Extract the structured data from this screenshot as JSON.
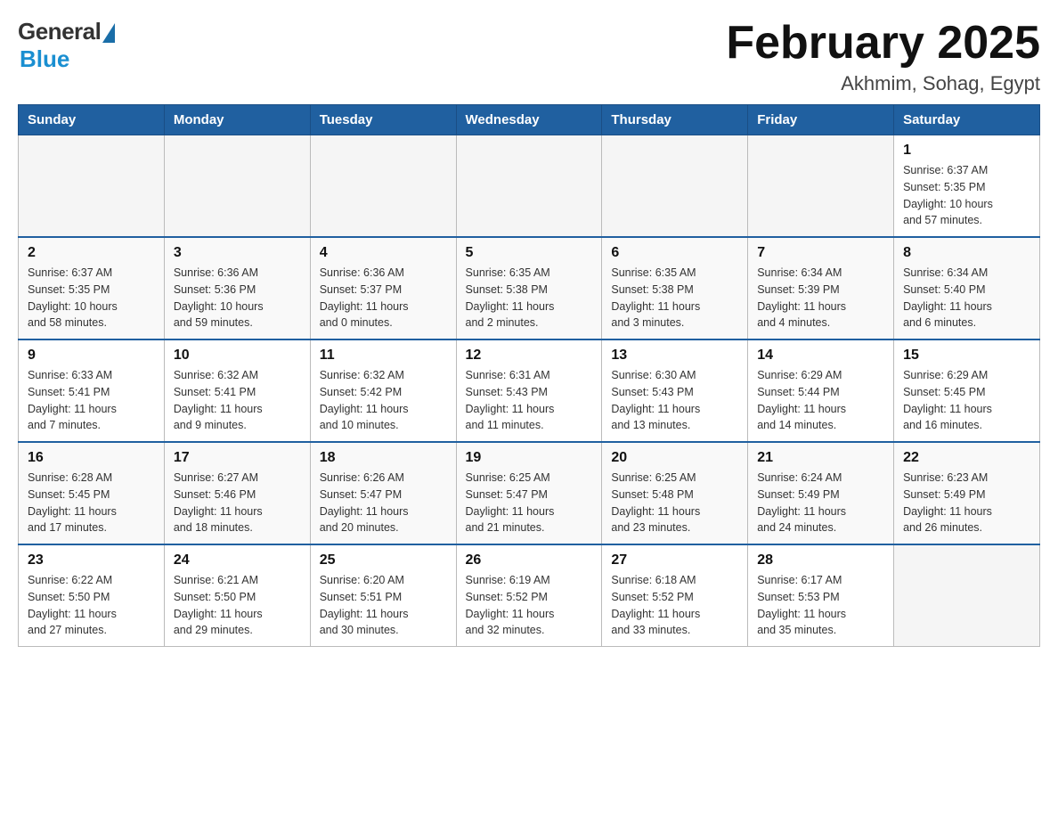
{
  "header": {
    "logo_general": "General",
    "logo_blue": "Blue",
    "month_title": "February 2025",
    "subtitle": "Akhmim, Sohag, Egypt"
  },
  "days_of_week": [
    "Sunday",
    "Monday",
    "Tuesday",
    "Wednesday",
    "Thursday",
    "Friday",
    "Saturday"
  ],
  "weeks": [
    {
      "days": [
        {
          "number": "",
          "info": ""
        },
        {
          "number": "",
          "info": ""
        },
        {
          "number": "",
          "info": ""
        },
        {
          "number": "",
          "info": ""
        },
        {
          "number": "",
          "info": ""
        },
        {
          "number": "",
          "info": ""
        },
        {
          "number": "1",
          "info": "Sunrise: 6:37 AM\nSunset: 5:35 PM\nDaylight: 10 hours\nand 57 minutes."
        }
      ]
    },
    {
      "days": [
        {
          "number": "2",
          "info": "Sunrise: 6:37 AM\nSunset: 5:35 PM\nDaylight: 10 hours\nand 58 minutes."
        },
        {
          "number": "3",
          "info": "Sunrise: 6:36 AM\nSunset: 5:36 PM\nDaylight: 10 hours\nand 59 minutes."
        },
        {
          "number": "4",
          "info": "Sunrise: 6:36 AM\nSunset: 5:37 PM\nDaylight: 11 hours\nand 0 minutes."
        },
        {
          "number": "5",
          "info": "Sunrise: 6:35 AM\nSunset: 5:38 PM\nDaylight: 11 hours\nand 2 minutes."
        },
        {
          "number": "6",
          "info": "Sunrise: 6:35 AM\nSunset: 5:38 PM\nDaylight: 11 hours\nand 3 minutes."
        },
        {
          "number": "7",
          "info": "Sunrise: 6:34 AM\nSunset: 5:39 PM\nDaylight: 11 hours\nand 4 minutes."
        },
        {
          "number": "8",
          "info": "Sunrise: 6:34 AM\nSunset: 5:40 PM\nDaylight: 11 hours\nand 6 minutes."
        }
      ]
    },
    {
      "days": [
        {
          "number": "9",
          "info": "Sunrise: 6:33 AM\nSunset: 5:41 PM\nDaylight: 11 hours\nand 7 minutes."
        },
        {
          "number": "10",
          "info": "Sunrise: 6:32 AM\nSunset: 5:41 PM\nDaylight: 11 hours\nand 9 minutes."
        },
        {
          "number": "11",
          "info": "Sunrise: 6:32 AM\nSunset: 5:42 PM\nDaylight: 11 hours\nand 10 minutes."
        },
        {
          "number": "12",
          "info": "Sunrise: 6:31 AM\nSunset: 5:43 PM\nDaylight: 11 hours\nand 11 minutes."
        },
        {
          "number": "13",
          "info": "Sunrise: 6:30 AM\nSunset: 5:43 PM\nDaylight: 11 hours\nand 13 minutes."
        },
        {
          "number": "14",
          "info": "Sunrise: 6:29 AM\nSunset: 5:44 PM\nDaylight: 11 hours\nand 14 minutes."
        },
        {
          "number": "15",
          "info": "Sunrise: 6:29 AM\nSunset: 5:45 PM\nDaylight: 11 hours\nand 16 minutes."
        }
      ]
    },
    {
      "days": [
        {
          "number": "16",
          "info": "Sunrise: 6:28 AM\nSunset: 5:45 PM\nDaylight: 11 hours\nand 17 minutes."
        },
        {
          "number": "17",
          "info": "Sunrise: 6:27 AM\nSunset: 5:46 PM\nDaylight: 11 hours\nand 18 minutes."
        },
        {
          "number": "18",
          "info": "Sunrise: 6:26 AM\nSunset: 5:47 PM\nDaylight: 11 hours\nand 20 minutes."
        },
        {
          "number": "19",
          "info": "Sunrise: 6:25 AM\nSunset: 5:47 PM\nDaylight: 11 hours\nand 21 minutes."
        },
        {
          "number": "20",
          "info": "Sunrise: 6:25 AM\nSunset: 5:48 PM\nDaylight: 11 hours\nand 23 minutes."
        },
        {
          "number": "21",
          "info": "Sunrise: 6:24 AM\nSunset: 5:49 PM\nDaylight: 11 hours\nand 24 minutes."
        },
        {
          "number": "22",
          "info": "Sunrise: 6:23 AM\nSunset: 5:49 PM\nDaylight: 11 hours\nand 26 minutes."
        }
      ]
    },
    {
      "days": [
        {
          "number": "23",
          "info": "Sunrise: 6:22 AM\nSunset: 5:50 PM\nDaylight: 11 hours\nand 27 minutes."
        },
        {
          "number": "24",
          "info": "Sunrise: 6:21 AM\nSunset: 5:50 PM\nDaylight: 11 hours\nand 29 minutes."
        },
        {
          "number": "25",
          "info": "Sunrise: 6:20 AM\nSunset: 5:51 PM\nDaylight: 11 hours\nand 30 minutes."
        },
        {
          "number": "26",
          "info": "Sunrise: 6:19 AM\nSunset: 5:52 PM\nDaylight: 11 hours\nand 32 minutes."
        },
        {
          "number": "27",
          "info": "Sunrise: 6:18 AM\nSunset: 5:52 PM\nDaylight: 11 hours\nand 33 minutes."
        },
        {
          "number": "28",
          "info": "Sunrise: 6:17 AM\nSunset: 5:53 PM\nDaylight: 11 hours\nand 35 minutes."
        },
        {
          "number": "",
          "info": ""
        }
      ]
    }
  ]
}
